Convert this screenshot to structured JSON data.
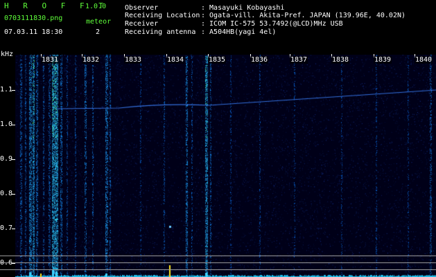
{
  "app": {
    "title": "H R O F F T",
    "version": "1.0.0"
  },
  "file": {
    "name": "0703111830.png",
    "timestamp": "07.03.11 18:30"
  },
  "meteor": {
    "label": "meteor",
    "count": "2"
  },
  "info": [
    {
      "label": "Observer",
      "value": ": Masayuki Kobayashi"
    },
    {
      "label": "Receiving Location",
      "value": ": Ogata-vill. Akita-Pref. JAPAN (139.96E, 40.02N)"
    },
    {
      "label": "Receiver",
      "value": ": ICOM IC-575 53.7492(@LCD)MHz USB"
    },
    {
      "label": "Receiving antenna",
      "value": ": A504HB(yagi 4el)"
    }
  ],
  "y_axis": {
    "unit": "kHz",
    "ticks": [
      "1.1",
      "1.0",
      "0.9",
      "0.8",
      "0.7",
      "0.6"
    ]
  },
  "x_axis": {
    "ticks": [
      "1831",
      "1832",
      "1833",
      "1834",
      "1835",
      "1836",
      "1837",
      "1838",
      "1839",
      "1840"
    ]
  },
  "colors": {
    "label": "#5fff3a",
    "value": "#ffffff",
    "tick": "#ffe81f",
    "noise": "#1a2fa0",
    "echo": "#3cd2ff"
  }
}
